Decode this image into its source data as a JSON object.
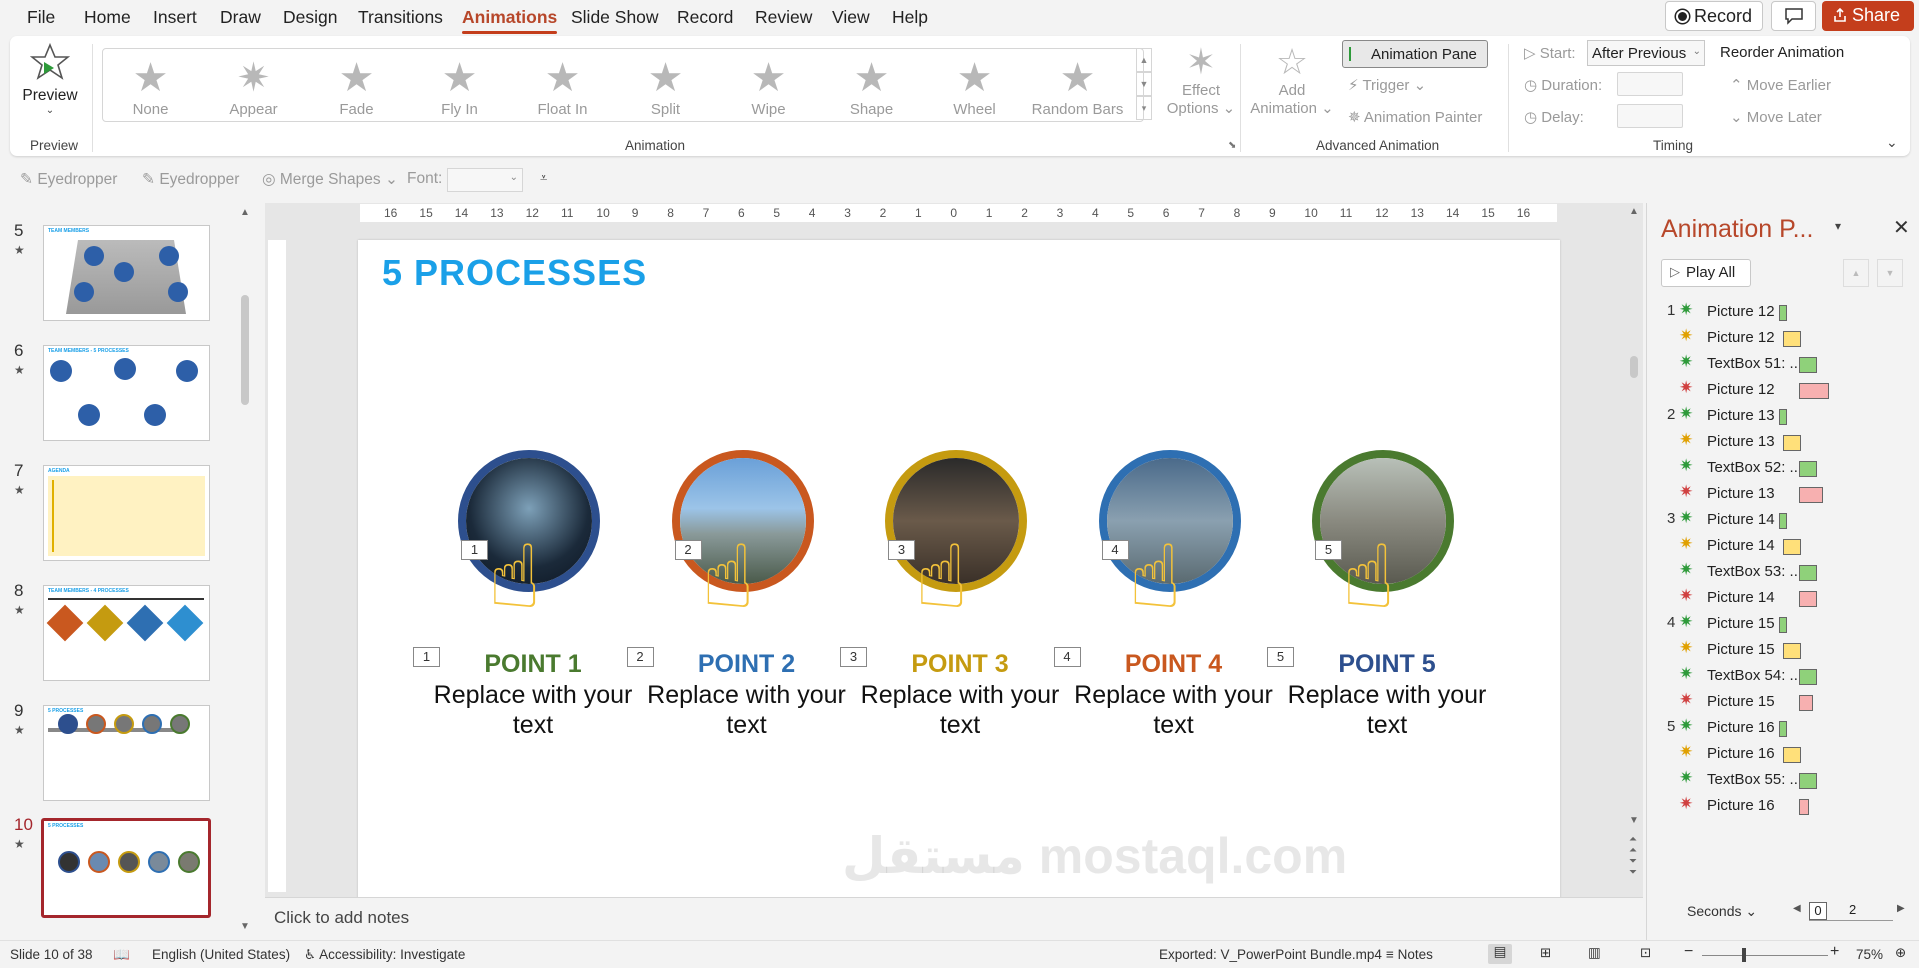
{
  "menu": {
    "items": [
      "File",
      "Home",
      "Insert",
      "Draw",
      "Design",
      "Transitions",
      "Animations",
      "Slide Show",
      "Record",
      "Review",
      "View",
      "Help"
    ],
    "record_label": "Record",
    "share_label": "Share"
  },
  "ribbon": {
    "preview_label": "Preview",
    "preview_group": "Preview",
    "animations": [
      "None",
      "Appear",
      "Fade",
      "Fly In",
      "Float In",
      "Split",
      "Wipe",
      "Shape",
      "Wheel",
      "Random Bars"
    ],
    "effect_options_line1": "Effect",
    "effect_options_line2": "Options",
    "animation_group": "Animation",
    "add_animation_line1": "Add",
    "add_animation_line2": "Animation",
    "animation_pane_label": "Animation Pane",
    "trigger_label": "Trigger",
    "animation_painter_label": "Animation Painter",
    "advanced_group": "Advanced Animation",
    "start_label": "Start:",
    "start_value": "After Previous",
    "duration_label": "Duration:",
    "delay_label": "Delay:",
    "reorder_label": "Reorder Animation",
    "move_earlier_label": "Move Earlier",
    "move_later_label": "Move Later",
    "timing_group": "Timing"
  },
  "quick_access": {
    "eyedropper1": "Eyedropper",
    "eyedropper2": "Eyedropper",
    "merge_shapes": "Merge Shapes",
    "font_label": "Font:"
  },
  "thumbnails": [
    {
      "num": "5",
      "title": "TEAM MEMBERS"
    },
    {
      "num": "6",
      "title": "TEAM MEMBERS - 5 PROCESSES"
    },
    {
      "num": "7",
      "title": "AGENDA"
    },
    {
      "num": "8",
      "title": "TEAM MEMBERS - 4 PROCESSES"
    },
    {
      "num": "9",
      "title": "5 PROCESSES"
    },
    {
      "num": "10",
      "title": "5 PROCESSES"
    }
  ],
  "ruler": {
    "h_ticks": [
      "16",
      "15",
      "14",
      "13",
      "12",
      "11",
      "10",
      "9",
      "8",
      "7",
      "6",
      "5",
      "4",
      "3",
      "2",
      "1",
      "0",
      "1",
      "2",
      "3",
      "4",
      "5",
      "6",
      "7",
      "8",
      "9",
      "10",
      "11",
      "12",
      "13",
      "14",
      "15",
      "16"
    ]
  },
  "slide": {
    "title": "5 PROCESSES",
    "points": [
      {
        "title": "POINT 1",
        "text": "Replace with your text",
        "color": "#4a7a2f",
        "ring": "#2d4f8e",
        "tag": "1"
      },
      {
        "title": "POINT 2",
        "text": "Replace with your text",
        "color": "#2e6fb2",
        "ring": "#c9581f",
        "tag": "2"
      },
      {
        "title": "POINT 3",
        "text": "Replace with your text",
        "color": "#c59b10",
        "ring": "#c59b10",
        "tag": "3"
      },
      {
        "title": "POINT 4",
        "text": "Replace with your text",
        "color": "#c9581f",
        "ring": "#2e6fb2",
        "tag": "4"
      },
      {
        "title": "POINT 5",
        "text": "Replace with your text",
        "color": "#2d4f8e",
        "ring": "#4a7a2f",
        "tag": "5"
      }
    ]
  },
  "notes_placeholder": "Click to add notes",
  "watermark": "مستقل mostaql.com",
  "pane": {
    "title": "Animation P...",
    "play_all": "Play All",
    "seconds_label": "Seconds",
    "scale_start": "0",
    "scale_end": "2",
    "groups": [
      {
        "num": "1",
        "items": [
          "Picture 12",
          "Picture 12",
          "TextBox 51: ...",
          "Picture 12"
        ]
      },
      {
        "num": "2",
        "items": [
          "Picture 13",
          "Picture 13",
          "TextBox 52: ...",
          "Picture 13"
        ]
      },
      {
        "num": "3",
        "items": [
          "Picture 14",
          "Picture 14",
          "TextBox 53: ...",
          "Picture 14"
        ]
      },
      {
        "num": "4",
        "items": [
          "Picture 15",
          "Picture 15",
          "TextBox 54: ...",
          "Picture 15"
        ]
      },
      {
        "num": "5",
        "items": [
          "Picture 16",
          "Picture 16",
          "TextBox 55: ...",
          "Picture 16"
        ]
      }
    ]
  },
  "status": {
    "slide_info": "Slide 10 of 38",
    "language": "English (United States)",
    "accessibility": "Accessibility: Investigate",
    "exported": "Exported: V_PowerPoint Bundle.mp4",
    "notes_label": "Notes",
    "zoom": "75%"
  },
  "colors": {
    "accent": "#c43e1c",
    "title_blue": "#1aa0e8",
    "entrance_green": "#8fd17a",
    "emphasis_yellow": "#ffe07a",
    "exit_red": "#f7b0b0"
  }
}
